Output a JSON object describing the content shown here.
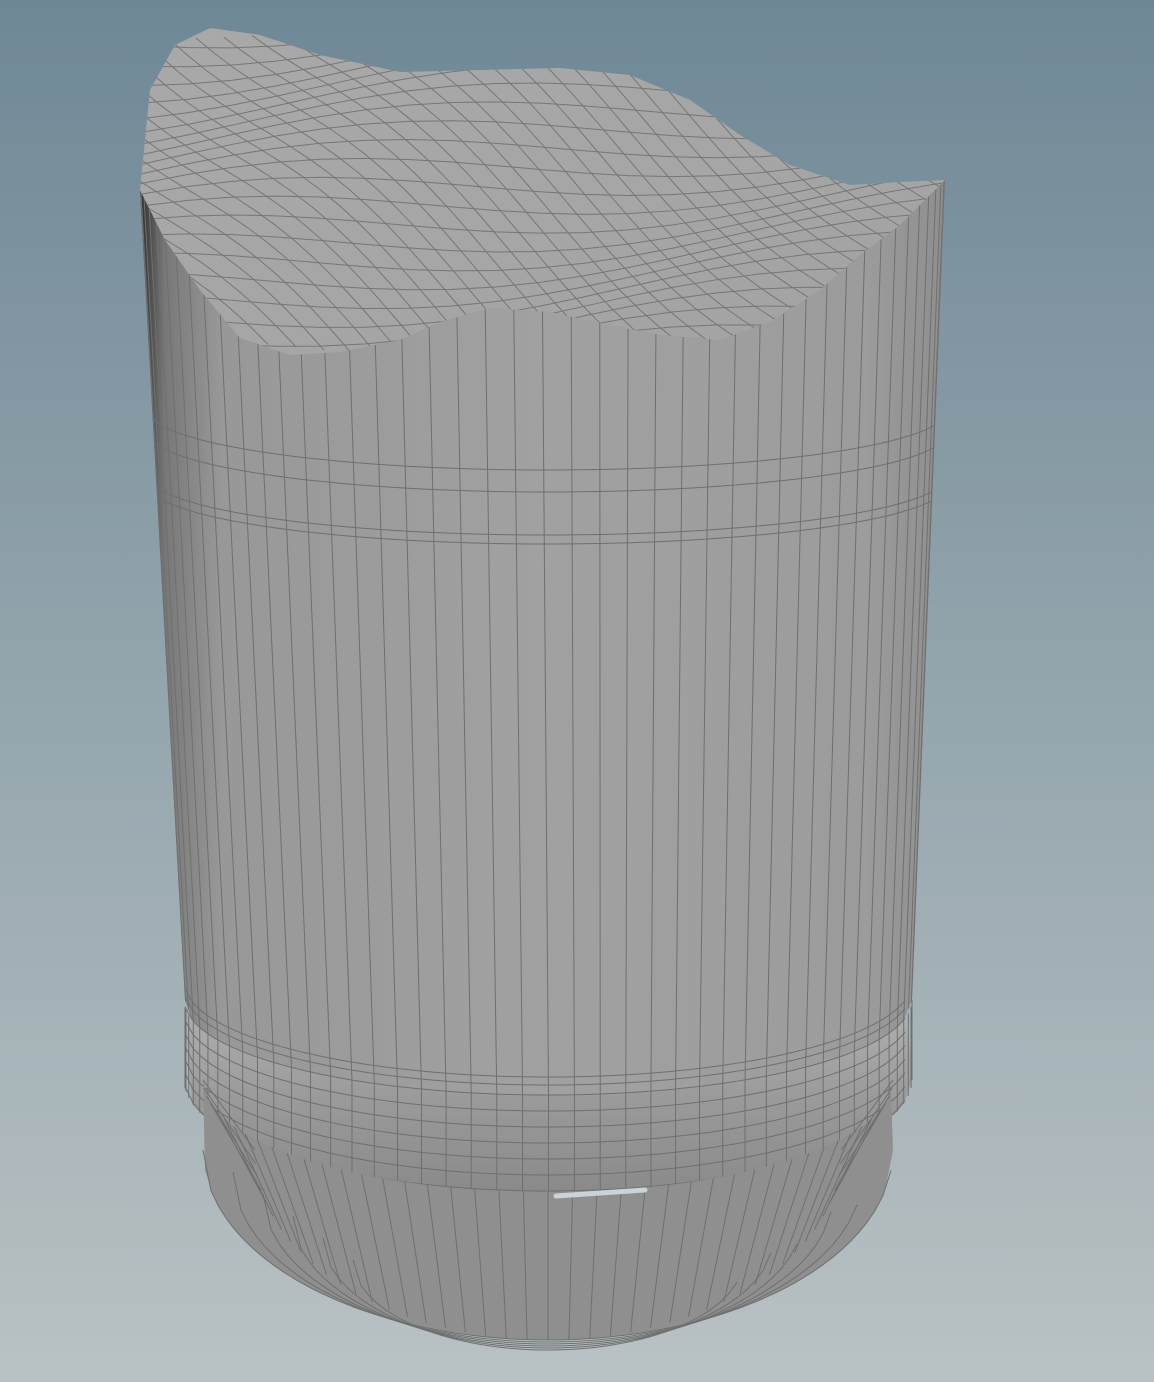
{
  "viewport": {
    "background_top": "#6f8896",
    "background_bottom": "#b9c2c4",
    "mesh_face": "#9d9d9d",
    "mesh_top": "#a8a8a8",
    "wire_color": "#6f6f6f",
    "highlight": "#c9d4d8"
  },
  "scene": {
    "object": "cylinder-mesh"
  }
}
